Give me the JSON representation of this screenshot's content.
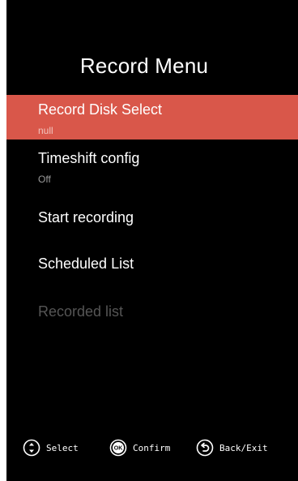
{
  "menu": {
    "title": "Record Menu",
    "items": [
      {
        "label": "Record Disk Select",
        "sub": "null"
      },
      {
        "label": "Timeshift config",
        "sub": "Off"
      },
      {
        "label": "Start recording"
      },
      {
        "label": "Scheduled List"
      },
      {
        "label": "Recorded list"
      }
    ]
  },
  "footer": {
    "select_label": "Select",
    "confirm_label": "Confirm",
    "back_label": "Back/Exit",
    "ok_glyph": "OK"
  },
  "colors": {
    "background": "#000000",
    "highlight": "#d9574a",
    "text": "#ffffff",
    "disabled_text": "#555555"
  }
}
